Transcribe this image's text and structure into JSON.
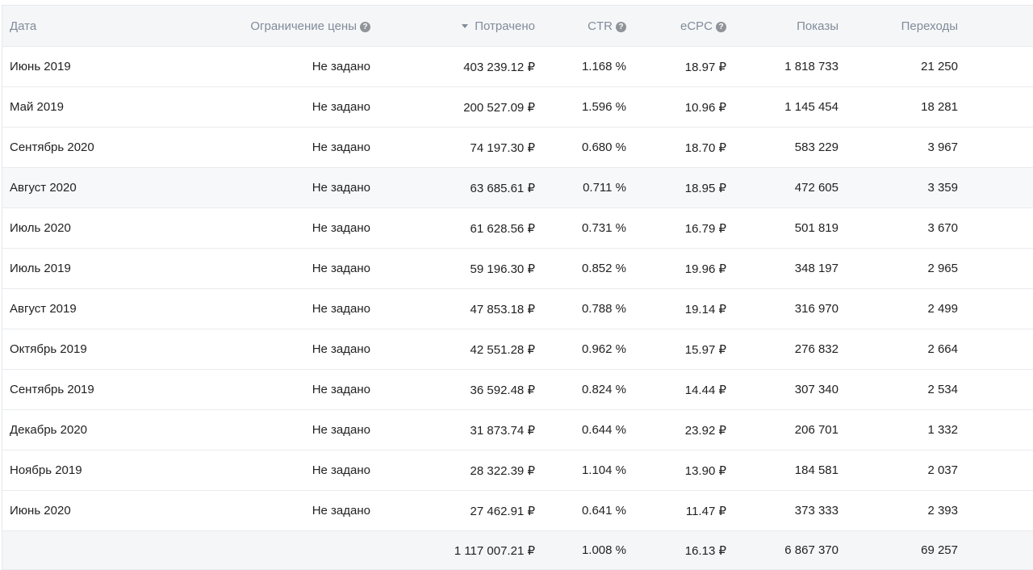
{
  "table": {
    "headers": {
      "date": "Дата",
      "price_limit": "Ограничение цены",
      "spent": "Потрачено",
      "ctr": "CTR",
      "ecpc": "eCPC",
      "impressions": "Показы",
      "clicks": "Переходы"
    },
    "help_glyph": "?",
    "rows": [
      {
        "date": "Июнь 2019",
        "limit": "Не задано",
        "spent": "403 239.12 ₽",
        "ctr": "1.168 %",
        "ecpc": "18.97 ₽",
        "impressions": "1 818 733",
        "clicks": "21 250"
      },
      {
        "date": "Май 2019",
        "limit": "Не задано",
        "spent": "200 527.09 ₽",
        "ctr": "1.596 %",
        "ecpc": "10.96 ₽",
        "impressions": "1 145 454",
        "clicks": "18 281"
      },
      {
        "date": "Сентябрь 2020",
        "limit": "Не задано",
        "spent": "74 197.30 ₽",
        "ctr": "0.680 %",
        "ecpc": "18.70 ₽",
        "impressions": "583 229",
        "clicks": "3 967"
      },
      {
        "date": "Август 2020",
        "limit": "Не задано",
        "spent": "63 685.61 ₽",
        "ctr": "0.711 %",
        "ecpc": "18.95 ₽",
        "impressions": "472 605",
        "clicks": "3 359"
      },
      {
        "date": "Июль 2020",
        "limit": "Не задано",
        "spent": "61 628.56 ₽",
        "ctr": "0.731 %",
        "ecpc": "16.79 ₽",
        "impressions": "501 819",
        "clicks": "3 670"
      },
      {
        "date": "Июль 2019",
        "limit": "Не задано",
        "spent": "59 196.30 ₽",
        "ctr": "0.852 %",
        "ecpc": "19.96 ₽",
        "impressions": "348 197",
        "clicks": "2 965"
      },
      {
        "date": "Август 2019",
        "limit": "Не задано",
        "spent": "47 853.18 ₽",
        "ctr": "0.788 %",
        "ecpc": "19.14 ₽",
        "impressions": "316 970",
        "clicks": "2 499"
      },
      {
        "date": "Октябрь 2019",
        "limit": "Не задано",
        "spent": "42 551.28 ₽",
        "ctr": "0.962 %",
        "ecpc": "15.97 ₽",
        "impressions": "276 832",
        "clicks": "2 664"
      },
      {
        "date": "Сентябрь 2019",
        "limit": "Не задано",
        "spent": "36 592.48 ₽",
        "ctr": "0.824 %",
        "ecpc": "14.44 ₽",
        "impressions": "307 340",
        "clicks": "2 534"
      },
      {
        "date": "Декабрь 2020",
        "limit": "Не задано",
        "spent": "31 873.74 ₽",
        "ctr": "0.644 %",
        "ecpc": "23.92 ₽",
        "impressions": "206 701",
        "clicks": "1 332"
      },
      {
        "date": "Ноябрь 2019",
        "limit": "Не задано",
        "spent": "28 322.39 ₽",
        "ctr": "1.104 %",
        "ecpc": "13.90 ₽",
        "impressions": "184 581",
        "clicks": "2 037"
      },
      {
        "date": "Июнь 2020",
        "limit": "Не задано",
        "spent": "27 462.91 ₽",
        "ctr": "0.641 %",
        "ecpc": "11.47 ₽",
        "impressions": "373 333",
        "clicks": "2 393"
      }
    ],
    "totals": {
      "spent": "1 117 007.21 ₽",
      "ctr": "1.008 %",
      "ecpc": "16.13 ₽",
      "impressions": "6 867 370",
      "clicks": "69 257"
    },
    "highlighted_row": "Август 2020",
    "sorted_column": "spent",
    "sort_direction": "descending",
    "colors": {
      "header_bg": "#f5f6f8",
      "header_text": "#818c99",
      "text": "#222222",
      "border": "#e9ebee",
      "help_icon": "#909499"
    }
  }
}
